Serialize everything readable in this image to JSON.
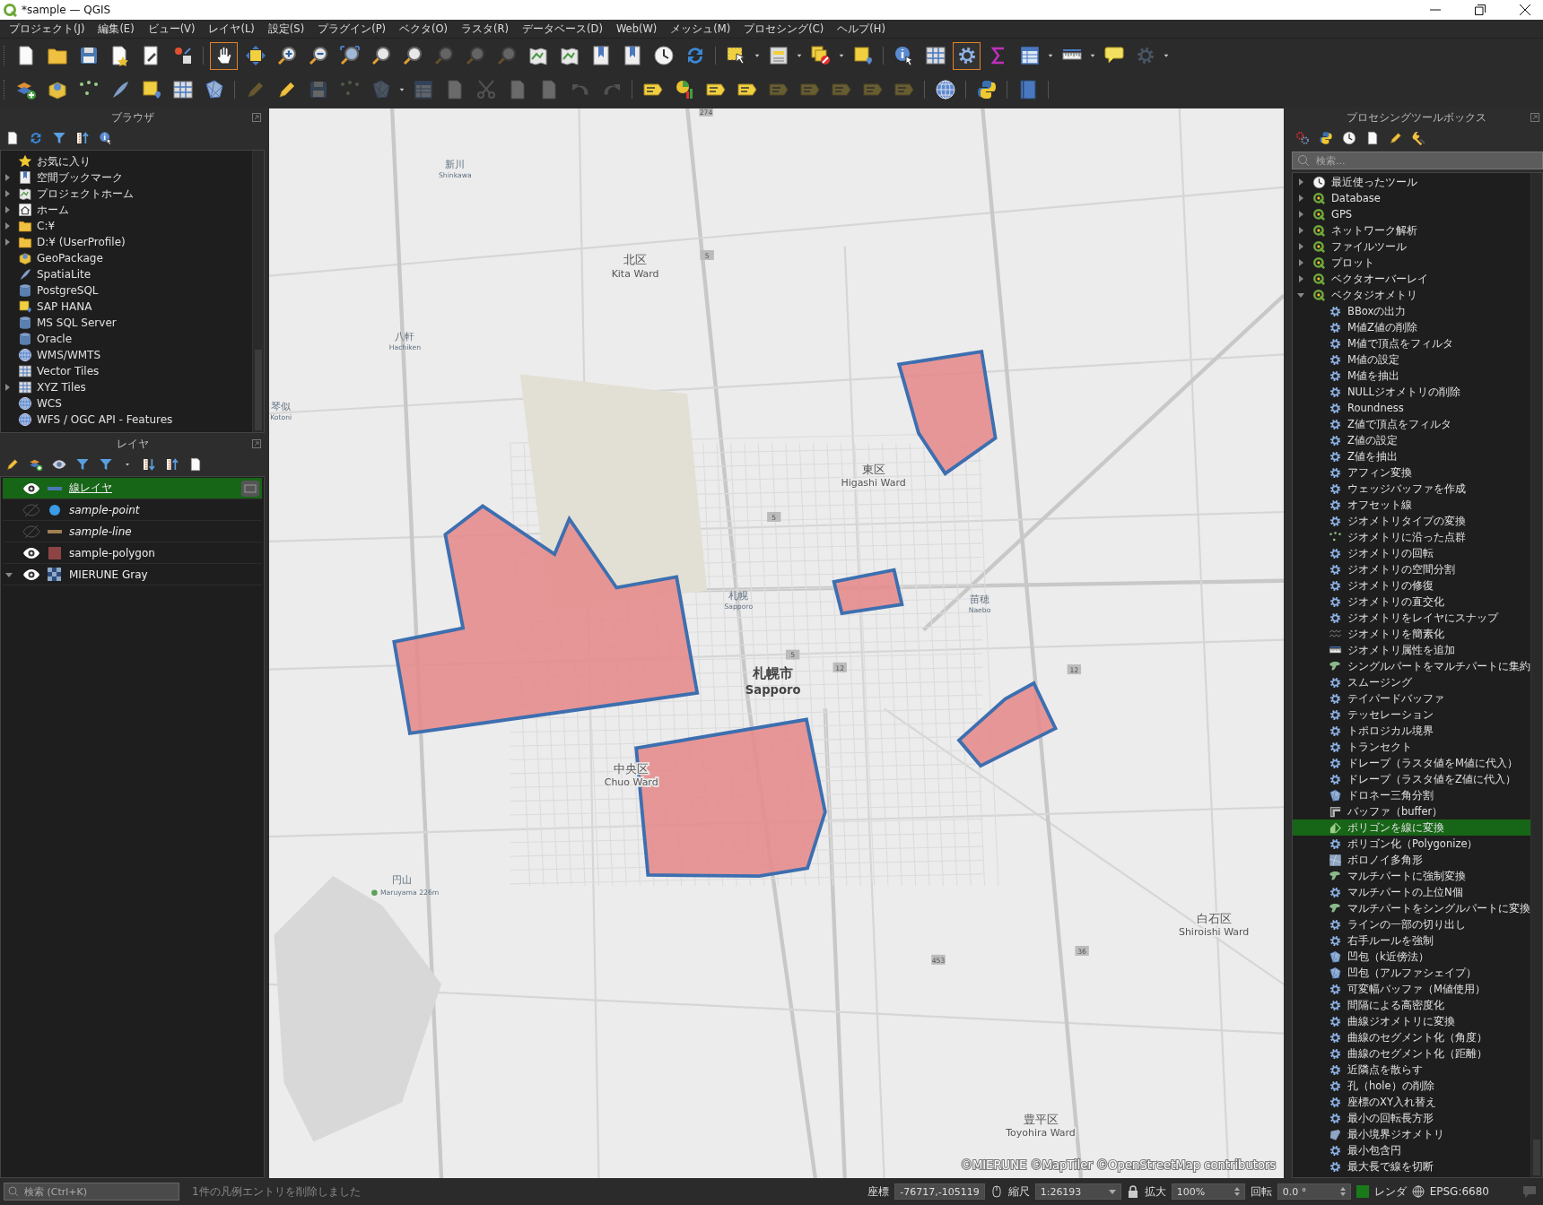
{
  "window": {
    "title": "*sample — QGIS"
  },
  "menu": [
    "プロジェクト(J)",
    "編集(E)",
    "ビュー(V)",
    "レイヤ(L)",
    "設定(S)",
    "プラグイン(P)",
    "ベクタ(O)",
    "ラスタ(R)",
    "データベース(D)",
    "Web(W)",
    "メッシュ(M)",
    "プロセシング(C)",
    "ヘルプ(H)"
  ],
  "toolbar_1": [
    {
      "kind": "page",
      "disabled": false,
      "selected": false
    },
    {
      "kind": "folder",
      "disabled": false,
      "selected": false
    },
    {
      "kind": "disk",
      "disabled": false,
      "selected": false
    },
    {
      "kind": "page-star",
      "disabled": false,
      "selected": false
    },
    {
      "kind": "page-tool",
      "disabled": false,
      "selected": false
    },
    {
      "kind": "style",
      "disabled": false,
      "selected": false
    },
    {
      "kind": "sep"
    },
    {
      "kind": "hand",
      "disabled": false,
      "selected": true
    },
    {
      "kind": "move",
      "disabled": false,
      "selected": false
    },
    {
      "kind": "zoom-in",
      "disabled": false,
      "selected": false
    },
    {
      "kind": "zoom-out",
      "disabled": false,
      "selected": false
    },
    {
      "kind": "zoom-full",
      "disabled": false,
      "selected": false
    },
    {
      "kind": "zoom",
      "disabled": false,
      "selected": false
    },
    {
      "kind": "zoom",
      "disabled": false,
      "selected": false
    },
    {
      "kind": "zoom",
      "disabled": true,
      "selected": false
    },
    {
      "kind": "zoom",
      "disabled": true,
      "selected": false
    },
    {
      "kind": "zoom",
      "disabled": true,
      "selected": false
    },
    {
      "kind": "map",
      "disabled": false,
      "selected": false
    },
    {
      "kind": "map",
      "disabled": false,
      "selected": false
    },
    {
      "kind": "bookmark",
      "disabled": false,
      "selected": false
    },
    {
      "kind": "bookmark",
      "disabled": false,
      "selected": false
    },
    {
      "kind": "clock",
      "disabled": false,
      "selected": false
    },
    {
      "kind": "refresh",
      "disabled": false,
      "selected": false
    },
    {
      "kind": "sep"
    },
    {
      "kind": "select",
      "disabled": false,
      "selected": false
    },
    {
      "kind": "caret"
    },
    {
      "kind": "table-select",
      "disabled": false,
      "selected": false
    },
    {
      "kind": "caret"
    },
    {
      "kind": "deselect",
      "disabled": false,
      "selected": false
    },
    {
      "kind": "caret"
    },
    {
      "kind": "square",
      "disabled": false,
      "selected": false
    },
    {
      "kind": "sep"
    },
    {
      "kind": "info",
      "disabled": false,
      "selected": false
    },
    {
      "kind": "grid",
      "disabled": false,
      "selected": false
    },
    {
      "kind": "gear",
      "disabled": false,
      "selected": true
    },
    {
      "kind": "sigma",
      "disabled": false,
      "selected": false
    },
    {
      "kind": "table",
      "disabled": false,
      "selected": false
    },
    {
      "kind": "caret"
    },
    {
      "kind": "ruler",
      "disabled": false,
      "selected": false
    },
    {
      "kind": "caret"
    },
    {
      "kind": "bubble",
      "disabled": false,
      "selected": false
    },
    {
      "kind": "gear",
      "disabled": true,
      "selected": false
    },
    {
      "kind": "caret"
    }
  ],
  "toolbar_2": [
    {
      "kind": "layers",
      "disabled": false,
      "selected": false
    },
    {
      "kind": "package",
      "disabled": false,
      "selected": false
    },
    {
      "kind": "points",
      "disabled": false,
      "selected": false
    },
    {
      "kind": "feather",
      "disabled": false,
      "selected": false
    },
    {
      "kind": "square",
      "disabled": false,
      "selected": false
    },
    {
      "kind": "grid",
      "disabled": false,
      "selected": false
    },
    {
      "kind": "mesh",
      "disabled": false,
      "selected": false
    },
    {
      "kind": "sep"
    },
    {
      "kind": "pencil",
      "disabled": true,
      "selected": false
    },
    {
      "kind": "pencil",
      "disabled": false,
      "selected": false
    },
    {
      "kind": "disk",
      "disabled": true,
      "selected": false
    },
    {
      "kind": "points",
      "disabled": true,
      "selected": false
    },
    {
      "kind": "mesh",
      "disabled": true,
      "selected": false
    },
    {
      "kind": "caret"
    },
    {
      "kind": "table",
      "disabled": true,
      "selected": false
    },
    {
      "kind": "page",
      "disabled": true,
      "selected": false
    },
    {
      "kind": "scissors",
      "disabled": true,
      "selected": false
    },
    {
      "kind": "page",
      "disabled": true,
      "selected": false
    },
    {
      "kind": "page",
      "disabled": true,
      "selected": false
    },
    {
      "kind": "undo",
      "disabled": true,
      "selected": false
    },
    {
      "kind": "redo",
      "disabled": true,
      "selected": false
    },
    {
      "kind": "sep"
    },
    {
      "kind": "label",
      "disabled": false,
      "selected": false
    },
    {
      "kind": "chart",
      "disabled": false,
      "selected": false
    },
    {
      "kind": "label",
      "disabled": false,
      "selected": false
    },
    {
      "kind": "label",
      "disabled": false,
      "selected": false
    },
    {
      "kind": "label",
      "disabled": true,
      "selected": false
    },
    {
      "kind": "label",
      "disabled": true,
      "selected": false
    },
    {
      "kind": "label",
      "disabled": true,
      "selected": false
    },
    {
      "kind": "label",
      "disabled": true,
      "selected": false
    },
    {
      "kind": "label",
      "disabled": true,
      "selected": false
    },
    {
      "kind": "sep"
    },
    {
      "kind": "globe",
      "disabled": false,
      "selected": false
    },
    {
      "kind": "sep"
    },
    {
      "kind": "python",
      "disabled": false,
      "selected": false
    },
    {
      "kind": "sep"
    },
    {
      "kind": "help",
      "disabled": false,
      "selected": false
    },
    {
      "kind": "sep"
    }
  ],
  "browser": {
    "title": "ブラウザ",
    "toolbar": [
      {
        "kind": "page"
      },
      {
        "kind": "refresh"
      },
      {
        "kind": "filter"
      },
      {
        "kind": "collapse"
      },
      {
        "kind": "info"
      }
    ],
    "items": [
      {
        "label": "お気に入り",
        "kind": "star",
        "expandable": false
      },
      {
        "label": "空間ブックマーク",
        "kind": "bookmark",
        "expandable": true
      },
      {
        "label": "プロジェクトホーム",
        "kind": "map",
        "expandable": true
      },
      {
        "label": "ホーム",
        "kind": "home",
        "expandable": true
      },
      {
        "label": "C:¥",
        "kind": "folder",
        "expandable": true
      },
      {
        "label": "D:¥ (UserProfile)",
        "kind": "folder",
        "expandable": true
      },
      {
        "label": "GeoPackage",
        "kind": "package",
        "expandable": false
      },
      {
        "label": "SpatiaLite",
        "kind": "feather",
        "expandable": false
      },
      {
        "label": "PostgreSQL",
        "kind": "db",
        "expandable": false
      },
      {
        "label": "SAP HANA",
        "kind": "square",
        "expandable": false
      },
      {
        "label": "MS SQL Server",
        "kind": "db",
        "expandable": false
      },
      {
        "label": "Oracle",
        "kind": "db",
        "expandable": false
      },
      {
        "label": "WMS/WMTS",
        "kind": "globe",
        "expandable": false
      },
      {
        "label": "Vector Tiles",
        "kind": "grid",
        "expandable": false
      },
      {
        "label": "XYZ Tiles",
        "kind": "grid",
        "expandable": true
      },
      {
        "label": "WCS",
        "kind": "globe",
        "expandable": false
      },
      {
        "label": "WFS / OGC API - Features",
        "kind": "globe",
        "expandable": false
      }
    ]
  },
  "layers": {
    "title": "レイヤ",
    "toolbar": [
      {
        "kind": "pencil"
      },
      {
        "kind": "layers"
      },
      {
        "kind": "eye"
      },
      {
        "kind": "filter"
      },
      {
        "kind": "filter"
      },
      {
        "kind": "caret"
      },
      {
        "kind": "expand"
      },
      {
        "kind": "collapse"
      },
      {
        "kind": "page"
      }
    ],
    "items": [
      {
        "name": "線レイヤ",
        "visible": true,
        "selected": true,
        "kind": "line",
        "color": "#4a78b4",
        "indicator": true,
        "expandable": false
      },
      {
        "name": "sample-point",
        "visible": false,
        "selected": false,
        "kind": "point",
        "color": "#3a9be8",
        "indicator": false,
        "expandable": false
      },
      {
        "name": "sample-line",
        "visible": false,
        "selected": false,
        "kind": "line",
        "color": "#a08052",
        "indicator": false,
        "expandable": false
      },
      {
        "name": "sample-polygon",
        "visible": true,
        "selected": false,
        "kind": "fill",
        "color": "#8e4444",
        "indicator": false,
        "expandable": false
      },
      {
        "name": "MIERUNE Gray",
        "visible": true,
        "selected": false,
        "kind": "raster",
        "color": "#8fa8c8",
        "indicator": false,
        "expandable": true
      }
    ]
  },
  "map": {
    "labels": [
      {
        "kind": "district",
        "name": "北区",
        "name_en": "Kita Ward"
      },
      {
        "kind": "district",
        "name": "東区",
        "name_en": "Higashi Ward"
      },
      {
        "kind": "city",
        "name": "札幌市",
        "name_en": "Sapporo"
      },
      {
        "kind": "district",
        "name": "中央区",
        "name_en": "Chuo Ward"
      },
      {
        "kind": "district",
        "name": "白石区",
        "name_en": "Shiroishi Ward"
      },
      {
        "kind": "district",
        "name": "豊平区",
        "name_en": "Toyohira Ward"
      },
      {
        "kind": "station",
        "name": "新川",
        "name_en": "Shinkawa"
      },
      {
        "kind": "station",
        "name": "八軒",
        "name_en": "Hachiken"
      },
      {
        "kind": "station",
        "name": "琴似",
        "name_en": "Kotoni"
      },
      {
        "kind": "station",
        "name": "札幌",
        "name_en": "Sapporo"
      },
      {
        "kind": "station",
        "name": "苗穂",
        "name_en": "Naebo"
      },
      {
        "kind": "peak",
        "name": "円山",
        "name_en": "Maruyama 226m"
      }
    ],
    "route_numbers": [
      "274",
      "5",
      "5",
      "5",
      "12",
      "12",
      "453",
      "36"
    ],
    "attribution": "©MIERUNE ©MapTiler ©OpenStreetMap contributors"
  },
  "toolbox": {
    "title": "プロセシングツールボックス",
    "toolbar": [
      {
        "kind": "gears"
      },
      {
        "kind": "python"
      },
      {
        "kind": "clock"
      },
      {
        "kind": "page"
      },
      {
        "kind": "pencil"
      },
      {
        "kind": "wrench"
      }
    ],
    "search": {
      "placeholder": "検索..."
    },
    "groups": [
      {
        "label": "最近使ったツール",
        "kind": "clock",
        "expanded": false
      },
      {
        "label": "Database",
        "kind": "ring",
        "expanded": false
      },
      {
        "label": "GPS",
        "kind": "ring",
        "expanded": false
      },
      {
        "label": "ネットワーク解析",
        "kind": "ring",
        "expanded": false
      },
      {
        "label": "ファイルツール",
        "kind": "ring",
        "expanded": false
      },
      {
        "label": "プロット",
        "kind": "ring",
        "expanded": false
      },
      {
        "label": "ベクタオーバーレイ",
        "kind": "ring",
        "expanded": false
      },
      {
        "label": "ベクタジオメトリ",
        "kind": "ring",
        "expanded": true,
        "children": [
          {
            "label": "BBoxの出力",
            "kind": "gear",
            "selected": false
          },
          {
            "label": "M値Z値の削除",
            "kind": "gear",
            "selected": false
          },
          {
            "label": "M値で頂点をフィルタ",
            "kind": "gear",
            "selected": false
          },
          {
            "label": "M値の設定",
            "kind": "gear",
            "selected": false
          },
          {
            "label": "M値を抽出",
            "kind": "gear",
            "selected": false
          },
          {
            "label": "NULLジオメトリの削除",
            "kind": "gear",
            "selected": false
          },
          {
            "label": "Roundness",
            "kind": "gear",
            "selected": false
          },
          {
            "label": "Z値で頂点をフィルタ",
            "kind": "gear",
            "selected": false
          },
          {
            "label": "Z値の設定",
            "kind": "gear",
            "selected": false
          },
          {
            "label": "Z値を抽出",
            "kind": "gear",
            "selected": false
          },
          {
            "label": "アフィン変換",
            "kind": "gear",
            "selected": false
          },
          {
            "label": "ウェッジバッファを作成",
            "kind": "gear",
            "selected": false
          },
          {
            "label": "オフセット線",
            "kind": "gear",
            "selected": false
          },
          {
            "label": "ジオメトリタイプの変換",
            "kind": "gear",
            "selected": false
          },
          {
            "label": "ジオメトリに沿った点群",
            "kind": "points",
            "selected": false
          },
          {
            "label": "ジオメトリの回転",
            "kind": "gear",
            "selected": false
          },
          {
            "label": "ジオメトリの空間分割",
            "kind": "gear",
            "selected": false
          },
          {
            "label": "ジオメトリの修復",
            "kind": "gear",
            "selected": false
          },
          {
            "label": "ジオメトリの直交化",
            "kind": "gear",
            "selected": false
          },
          {
            "label": "ジオメトリをレイヤにスナップ",
            "kind": "gear",
            "selected": false
          },
          {
            "label": "ジオメトリを簡素化",
            "kind": "wave",
            "selected": false
          },
          {
            "label": "ジオメトリ属性を追加",
            "kind": "ruler",
            "selected": false
          },
          {
            "label": "シングルパートをマルチパートに集約",
            "kind": "blob",
            "selected": false
          },
          {
            "label": "スムージング",
            "kind": "gear",
            "selected": false
          },
          {
            "label": "テイパードバッファ",
            "kind": "gear",
            "selected": false
          },
          {
            "label": "テッセレーション",
            "kind": "gear",
            "selected": false
          },
          {
            "label": "トポロジカル境界",
            "kind": "gear",
            "selected": false
          },
          {
            "label": "トランセクト",
            "kind": "gear",
            "selected": false
          },
          {
            "label": "ドレープ（ラスタ値をM値に代入）",
            "kind": "gear",
            "selected": false
          },
          {
            "label": "ドレープ（ラスタ値をZ値に代入）",
            "kind": "gear",
            "selected": false
          },
          {
            "label": "ドロネー三角分割",
            "kind": "mesh",
            "selected": false
          },
          {
            "label": "バッファ（buffer）",
            "kind": "buffer",
            "selected": false
          },
          {
            "label": "ポリゴンを線に変換",
            "kind": "half",
            "selected": true
          },
          {
            "label": "ポリゴン化（Polygonize）",
            "kind": "gear",
            "selected": false
          },
          {
            "label": "ボロノイ多角形",
            "kind": "voronoi",
            "selected": false
          },
          {
            "label": "マルチパートに強制変換",
            "kind": "blob",
            "selected": false
          },
          {
            "label": "マルチパートの上位N個",
            "kind": "gear",
            "selected": false
          },
          {
            "label": "マルチパートをシングルパートに変換",
            "kind": "blob",
            "selected": false
          },
          {
            "label": "ラインの一部の切り出し",
            "kind": "gear",
            "selected": false
          },
          {
            "label": "右手ルールを強制",
            "kind": "gear",
            "selected": false
          },
          {
            "label": "凹包（k近傍法）",
            "kind": "mesh",
            "selected": false
          },
          {
            "label": "凹包（アルファシェイプ）",
            "kind": "mesh",
            "selected": false
          },
          {
            "label": "可変幅バッファ（M値使用）",
            "kind": "gear",
            "selected": false
          },
          {
            "label": "間隔による高密度化",
            "kind": "gear",
            "selected": false
          },
          {
            "label": "曲線ジオメトリに変換",
            "kind": "gear",
            "selected": false
          },
          {
            "label": "曲線のセグメント化（角度）",
            "kind": "gear",
            "selected": false
          },
          {
            "label": "曲線のセグメント化（距離）",
            "kind": "gear",
            "selected": false
          },
          {
            "label": "近隣点を散らす",
            "kind": "gear",
            "selected": false
          },
          {
            "label": "孔（hole）の削除",
            "kind": "gear",
            "selected": false
          },
          {
            "label": "座標のXY入れ替え",
            "kind": "gear",
            "selected": false
          },
          {
            "label": "最小の回転長方形",
            "kind": "gear",
            "selected": false
          },
          {
            "label": "最小境界ジオメトリ",
            "kind": "shield",
            "selected": false
          },
          {
            "label": "最小包含円",
            "kind": "gear",
            "selected": false
          },
          {
            "label": "最大長で線を切断",
            "kind": "gear",
            "selected": false
          }
        ]
      }
    ]
  },
  "status_bar": {
    "search": {
      "placeholder": "検索 (Ctrl+K)"
    },
    "message": "1件の凡例エントリを削除しました",
    "coordinate_label": "座標",
    "coordinate": "-76717,-105119",
    "scale_label": "縮尺",
    "scale": "1:26193",
    "magnifier_label": "拡大",
    "magnifier": "100%",
    "rotation_label": "回転",
    "rotation": "0.0 °",
    "render": {
      "label": "レンダ",
      "checked": true
    },
    "crs": "EPSG:6680"
  }
}
